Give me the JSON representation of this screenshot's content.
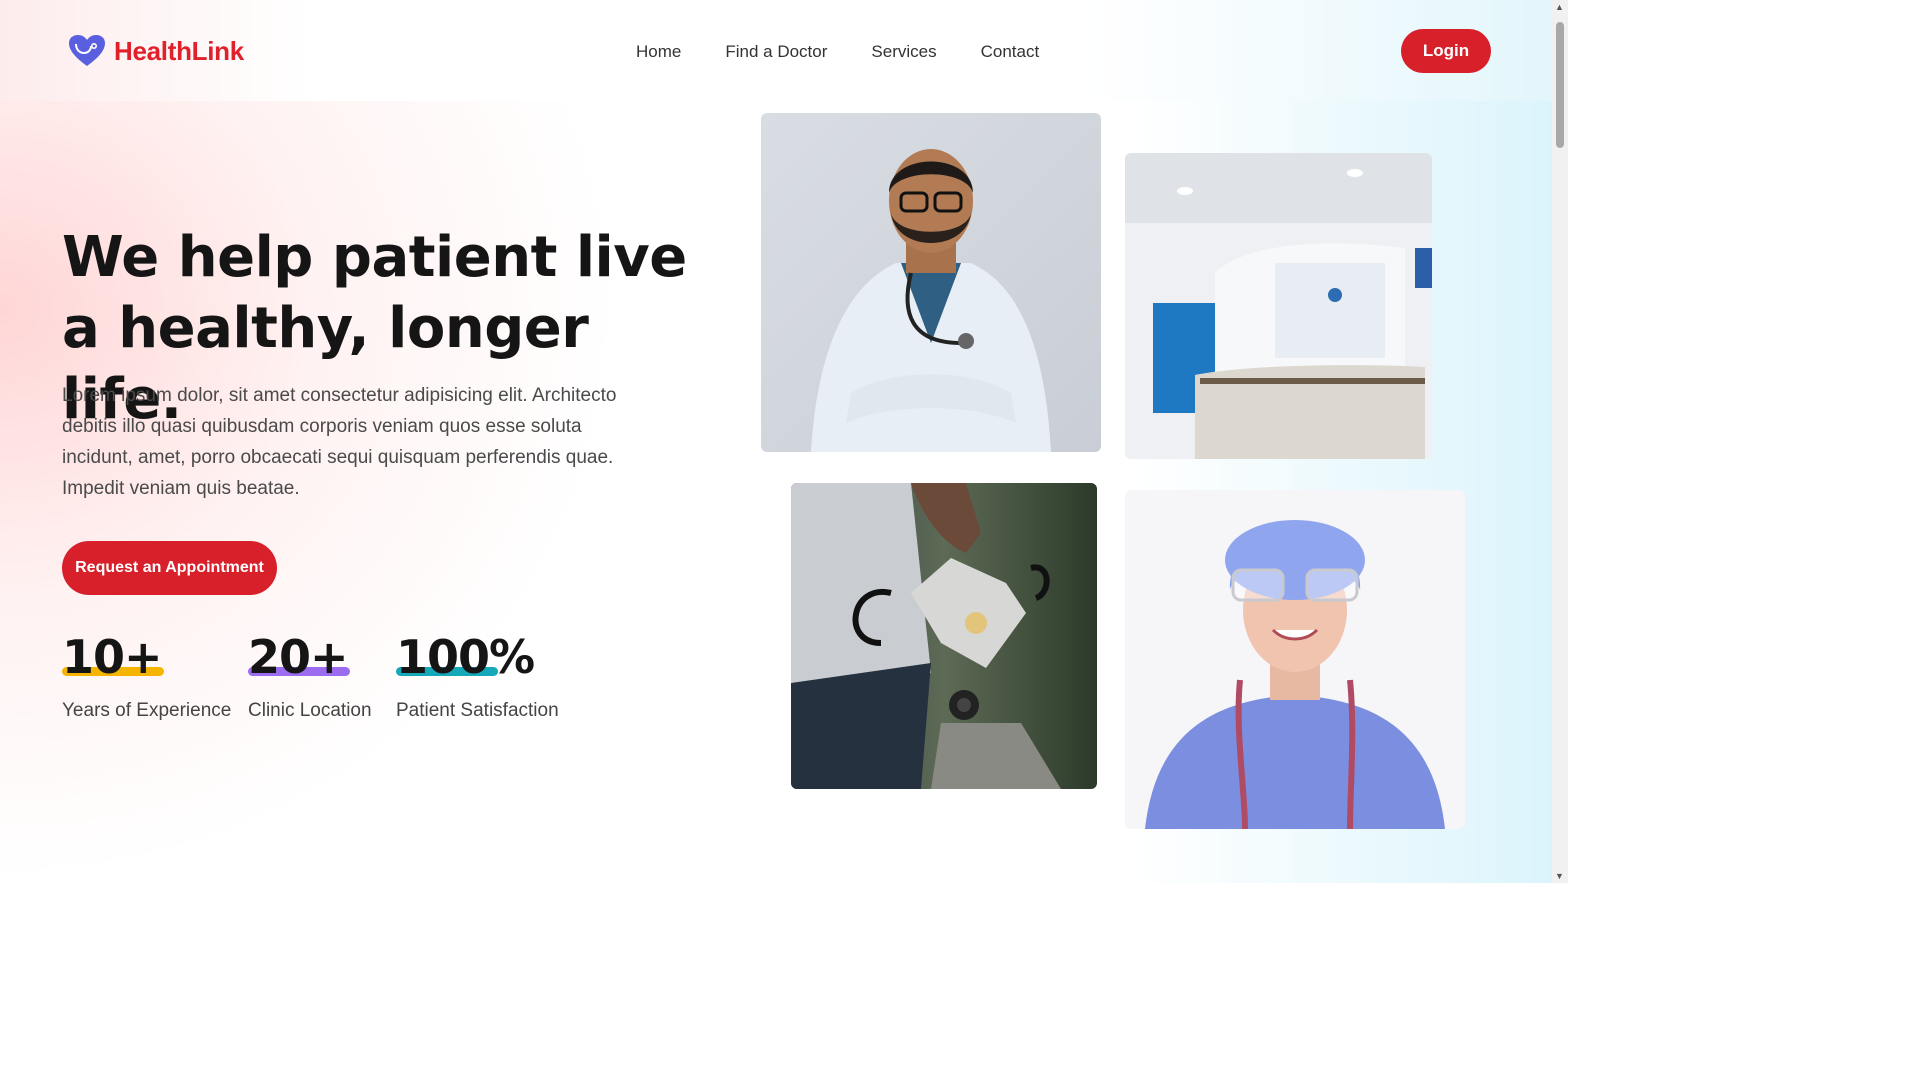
{
  "brand": {
    "name": "HealthLink",
    "accent": "#d7202a",
    "logo_color": "#5a5fe0"
  },
  "nav": {
    "items": [
      "Home",
      "Find a Doctor",
      "Services",
      "Contact"
    ]
  },
  "header": {
    "login_label": "Login"
  },
  "hero": {
    "title_line1": "We help patient live",
    "title_line2": "a healthy, longer life.",
    "description": "Lorem ipsum dolor, sit amet consectetur adipisicing elit. Architecto debitis illo quasi quibusdam corporis veniam quos esse soluta incidunt, amet, porro obcaecati sequi quisquam perferendis quae. Impedit veniam quis beatae.",
    "cta_label": "Request an Appointment"
  },
  "stats": [
    {
      "value": "10+",
      "label": "Years of Experience",
      "color": "#f5b400"
    },
    {
      "value": "20+",
      "label": "Clinic Location",
      "color": "#9b6cf0"
    },
    {
      "value": "100%",
      "label": "Patient Satisfaction",
      "color": "#14a8b8"
    }
  ],
  "images": [
    "doctor-portrait",
    "clinic-reception",
    "stethoscope-mask",
    "nurse-portrait"
  ]
}
